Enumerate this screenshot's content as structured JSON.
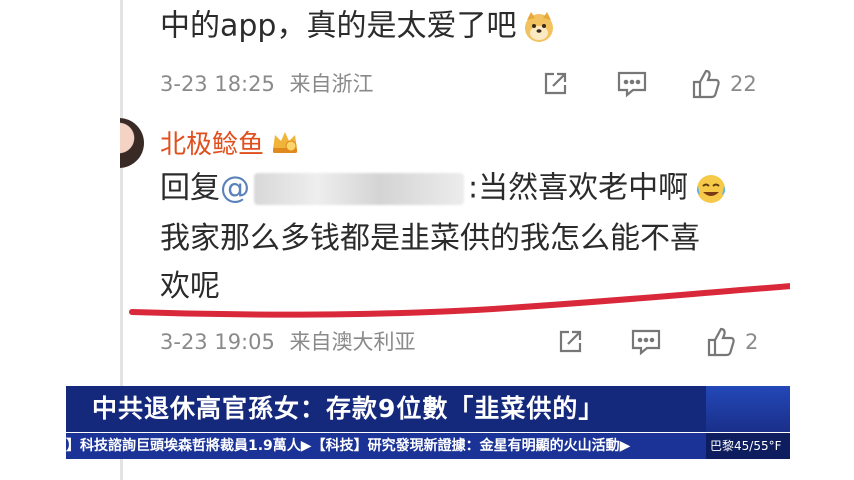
{
  "comment1": {
    "text_line": "中的app，真的是太爱了吧",
    "emoji": "doge-emoji",
    "time": "3-23 18:25",
    "location": "来自浙江",
    "likes": "22"
  },
  "comment2": {
    "username": "北极鲶鱼",
    "reply_prefix": "回复",
    "mention_at": "@",
    "reply_suffix": ":当然喜欢老中啊",
    "line2": "我家那么多钱都是韭菜供的我怎么能不喜",
    "line3": "欢呢",
    "time": "3-23 19:05",
    "location": "来自澳大利亚",
    "likes": "2"
  },
  "news": {
    "headline": "中共退休高官孫女：存款9位數「韭菜供的」",
    "ticker": "】科技諮詢巨頭埃森哲將裁員1.9萬人▶【科技】研究發現新證據：金星有明顯的火山活動▶",
    "weather": "巴黎45/55°F"
  },
  "colors": {
    "username": "#e0501f",
    "mention": "#5a82b8",
    "underline": "#d8283a",
    "headline_bg": "#15297c",
    "ticker_bg": "#1b3397"
  }
}
